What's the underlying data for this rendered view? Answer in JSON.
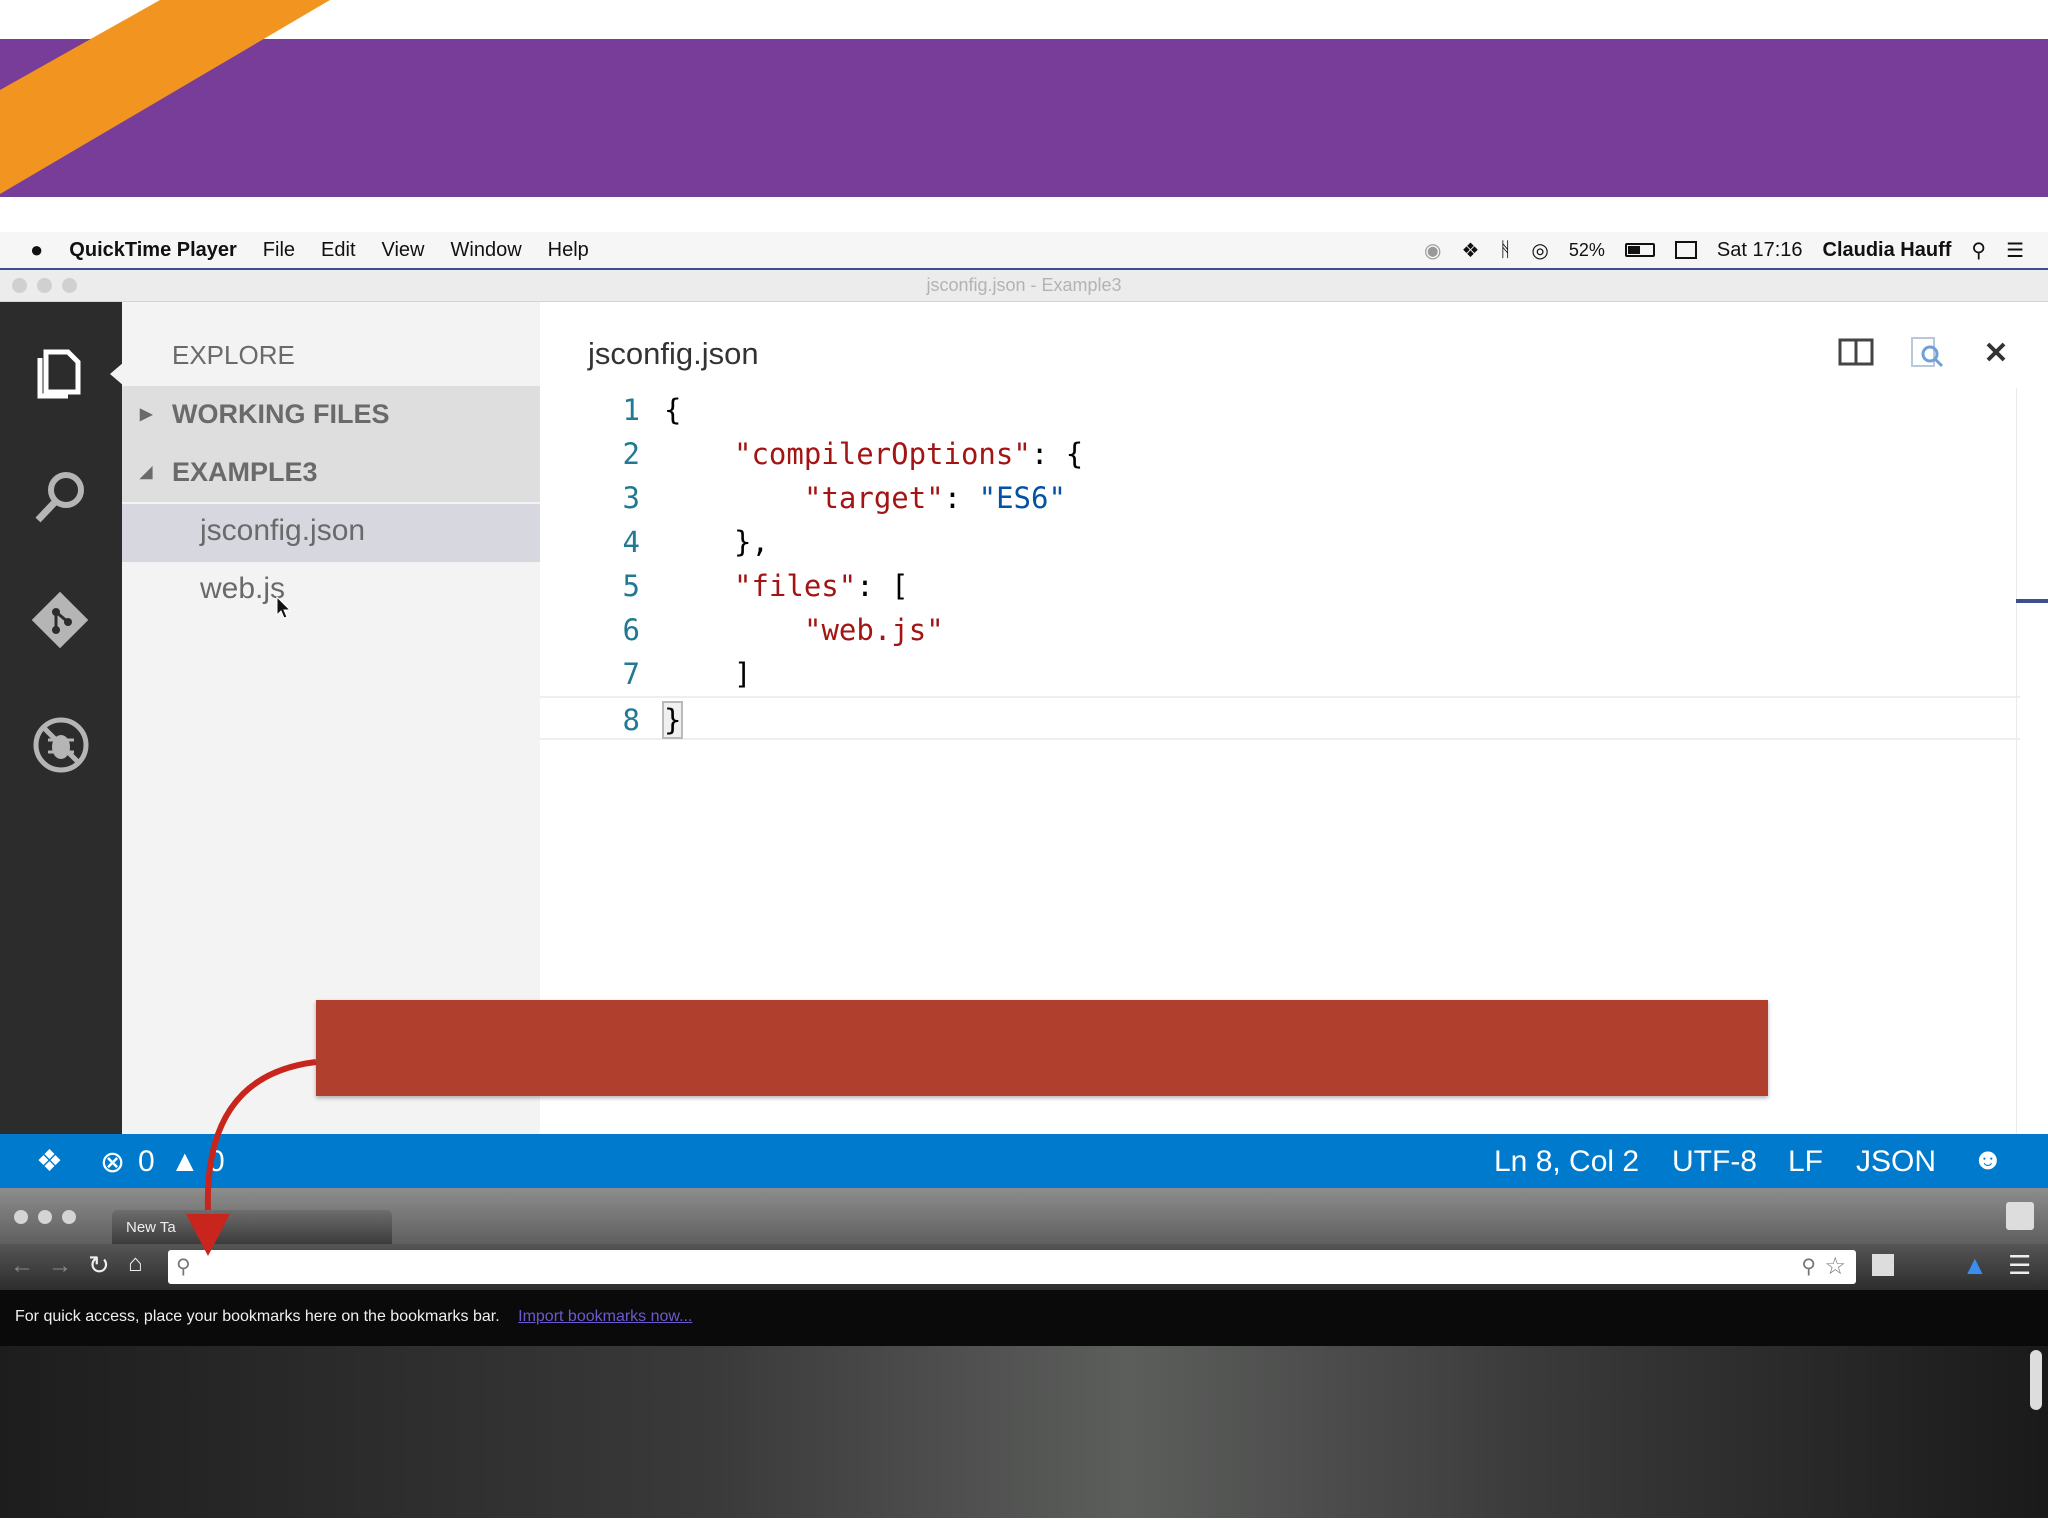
{
  "menubar": {
    "apple_icon": "apple-icon",
    "app_name": "QuickTime Player",
    "items": [
      "File",
      "Edit",
      "View",
      "Window",
      "Help"
    ],
    "battery": "52%",
    "clock": "Sat 17:16",
    "user": "Claudia Hauff"
  },
  "window": {
    "title": "jsconfig.json - Example3"
  },
  "sidebar": {
    "heading": "EXPLORE",
    "sections": [
      {
        "label": "WORKING FILES",
        "expanded": false
      },
      {
        "label": "EXAMPLE3",
        "expanded": true
      }
    ],
    "files": [
      {
        "label": "jsconfig.json",
        "selected": true
      },
      {
        "label": "web.js",
        "selected": false
      }
    ]
  },
  "editor": {
    "filename": "jsconfig.json",
    "line_numbers": [
      "1",
      "2",
      "3",
      "4",
      "5",
      "6",
      "7",
      "8"
    ],
    "tokens": {
      "open_brace": "{",
      "compiler_options_key": "\"compilerOptions\"",
      "colon_open": ": {",
      "target_key": "\"target\"",
      "colon": ": ",
      "target_value": "\"ES6\"",
      "close_obj": "},",
      "files_key": "\"files\"",
      "colon_bracket": ": [",
      "files_value": "\"web.js\"",
      "close_bracket": "]",
      "close_brace": "}"
    }
  },
  "statusbar": {
    "errors": "0",
    "warnings": "0",
    "position": "Ln 8, Col 2",
    "encoding": "UTF-8",
    "eol": "LF",
    "language": "JSON"
  },
  "browser": {
    "tab_title": "New Ta",
    "bookmark_message": "For quick access, place your bookmarks here on the bookmarks bar.",
    "import_link": "Import bookmarks now..."
  },
  "colors": {
    "header_purple": "#773d98",
    "stripe_orange": "#f29420",
    "callout_red": "#b13f2e",
    "statusbar_blue": "#007acc",
    "arrow_red": "#c8261c"
  }
}
